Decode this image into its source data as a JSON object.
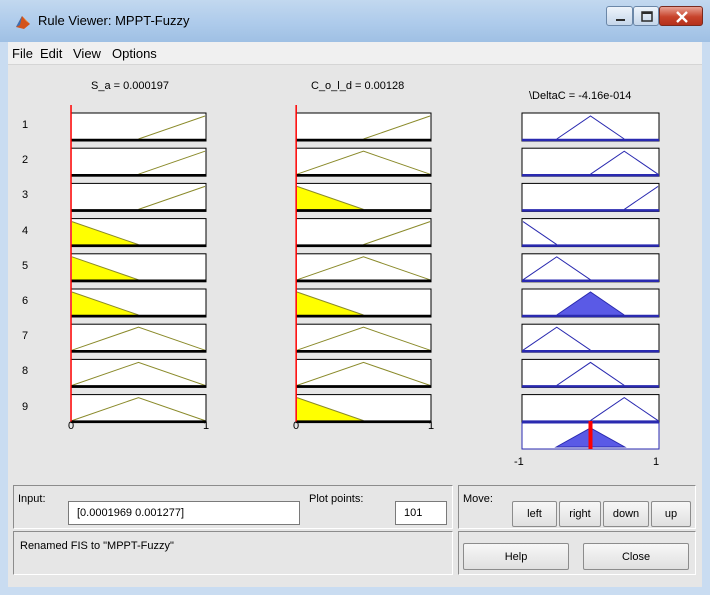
{
  "window": {
    "title": "Rule Viewer: MPPT-Fuzzy"
  },
  "menu": [
    "File",
    "Edit",
    "View",
    "Options"
  ],
  "columns": [
    {
      "label": "S_a = 0.000197",
      "mf_shapes": [
        "ramp-up",
        "ramp-up",
        "ramp-up",
        "ramp-down",
        "ramp-down",
        "ramp-down",
        "triangle",
        "triangle",
        "triangle"
      ],
      "fired_rules": [
        4,
        5,
        6
      ],
      "input_value": 0.000197,
      "x_ticks": [
        "0",
        "1"
      ]
    },
    {
      "label": "C_o_l_d = 0.00128",
      "mf_shapes": [
        "ramp-up",
        "triangle",
        "ramp-down",
        "ramp-up",
        "triangle",
        "ramp-down",
        "triangle",
        "triangle",
        "ramp-down"
      ],
      "fired_rules": [
        3,
        6,
        9
      ],
      "input_value": 0.00128,
      "x_ticks": [
        "0",
        "1"
      ]
    },
    {
      "label": "\\DeltaC = -4.16e-014",
      "mf_shapes": [
        "center",
        "right",
        "ramp-right",
        "ramp-left",
        "left",
        "center",
        "left",
        "center",
        "right"
      ],
      "fired_rules": [
        6
      ],
      "output_value": -4.16e-14,
      "x_ticks": [
        "-1",
        "1"
      ]
    }
  ],
  "rule_numbers": [
    "1",
    "2",
    "3",
    "4",
    "5",
    "6",
    "7",
    "8",
    "9"
  ],
  "bottom": {
    "input_label": "Input:",
    "input_value": "[0.0001969 0.001277]",
    "plot_points_label": "Plot points:",
    "plot_points_value": "101",
    "move_label": "Move:",
    "move_buttons": [
      "left",
      "right",
      "down",
      "up"
    ],
    "status": "Renamed FIS to \"MPPT-Fuzzy\"",
    "help_label": "Help",
    "close_label": "Close"
  },
  "colors": {
    "input_mf_line": "#8a8a2a",
    "input_fill": "#ffff00",
    "output_mf_line": "#2a2ab0",
    "output_fill": "#5a5ae6",
    "cursor_line": "#ff0000"
  }
}
